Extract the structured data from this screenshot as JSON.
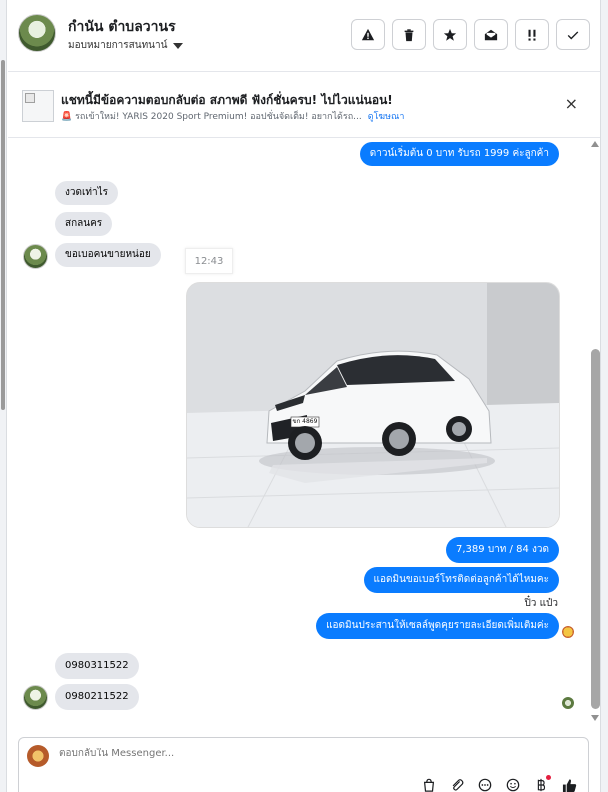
{
  "header": {
    "name": "กำนัน ตำบลวานร",
    "assign_label": "มอบหมายการสนทนาน์",
    "actions": [
      {
        "name": "report",
        "icon": "warning-icon"
      },
      {
        "name": "delete",
        "icon": "trash-icon"
      },
      {
        "name": "star",
        "icon": "star-icon"
      },
      {
        "name": "mark-unread",
        "icon": "envelope-open-icon"
      },
      {
        "name": "mark-important",
        "icon": "exclamation-icon"
      },
      {
        "name": "done",
        "icon": "checkmark-icon"
      }
    ]
  },
  "ad": {
    "title": "แชทนี้มีข้อความตอบกลับต่อ สภาพดี ฟังก์ชั่นครบ! ไปไวแน่นอน!",
    "subtitle": "🚨 รถเข้าใหม่! YARIS 2020 Sport Premium! ออปชั่นจัดเต็ม! อยากได้รถ...",
    "link": "ดูโฆษณา",
    "close": "×"
  },
  "messages": {
    "m1": "ดาวน์เริ่มต้น 0 บาท รับรถ 1999 ค่ะลูกค้า",
    "m2": "งวดเท่าไร",
    "m3": "สกลนคร",
    "m4": "ขอเบอคนขายหน่อย",
    "time": "12:43",
    "plate": "ขก 4869",
    "m5": "7,389 บาท  / 84 งวด",
    "m6": "แอดมินขอเบอร์โทรติดต่อลูกค้าได้ไหมคะ",
    "seen_name": "ปิ๋ว แป๋ว",
    "m7": "แอดมินประสานให้เซลล์พูดคุยรายละเอียดเพิ่มเติมค่ะ",
    "m8": "0980311522",
    "m9": "0980211522"
  },
  "composer": {
    "placeholder": "ตอบกลับใน Messenger...",
    "tools": [
      "bag-icon",
      "paperclip-icon",
      "chat-dots-icon",
      "emoji-icon",
      "baht-icon",
      "thumbs-up-icon"
    ]
  },
  "colors": {
    "outgoing": "#0a7cff",
    "incoming": "#e4e6eb",
    "link": "#1877f2"
  }
}
